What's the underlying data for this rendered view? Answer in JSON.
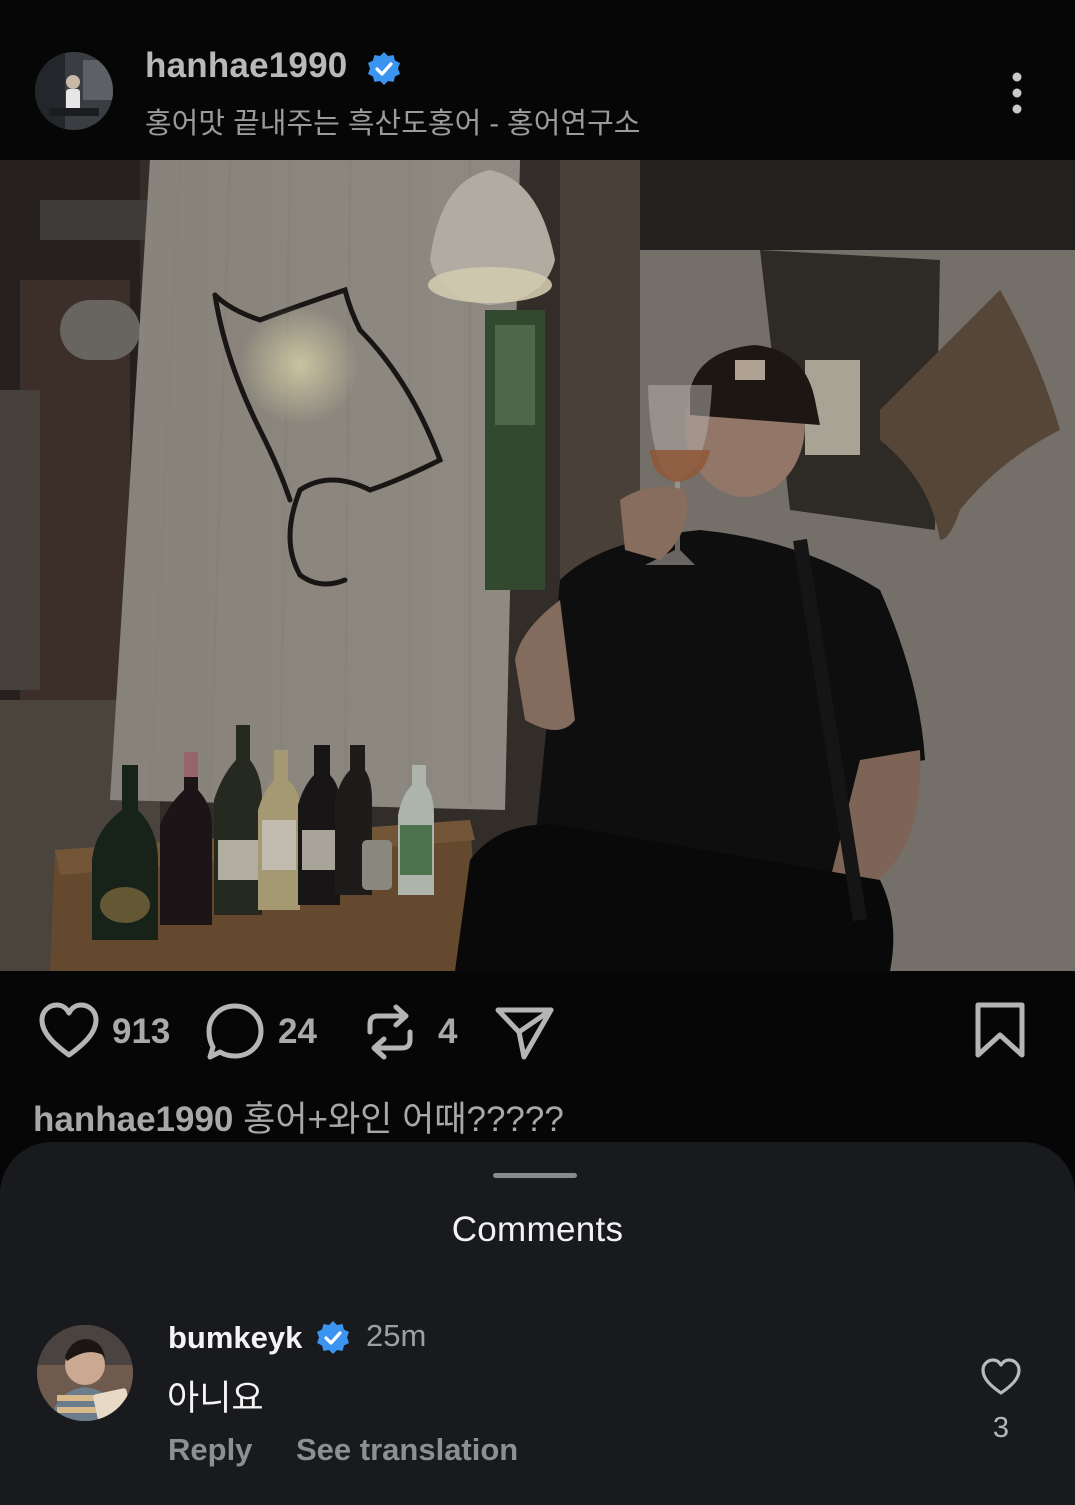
{
  "post": {
    "username": "hanhae1990",
    "location": "홍어맛 끝내주는 흑산도홍어 - 홍어연구소",
    "verified": true,
    "likes": "913",
    "comments": "24",
    "reposts": "4",
    "caption_user": "hanhae1990",
    "caption_text": "홍어+와인 어때?????"
  },
  "comments_sheet": {
    "title": "Comments",
    "items": [
      {
        "username": "bumkeyk",
        "verified": true,
        "time": "25m",
        "text": "아니요",
        "reply_label": "Reply",
        "translate_label": "See translation",
        "like_count": "3"
      }
    ]
  },
  "colors": {
    "background": "#060606",
    "sheet": "#181a1e",
    "verified_blue": "#3b95f0",
    "muted_text": "#9d9fa3"
  },
  "icons": {
    "like": "heart-icon",
    "comment": "comment-bubble-icon",
    "repost": "repost-icon",
    "share": "paper-plane-icon",
    "save": "bookmark-icon",
    "more": "more-vertical-icon",
    "verified": "verified-badge-icon"
  }
}
